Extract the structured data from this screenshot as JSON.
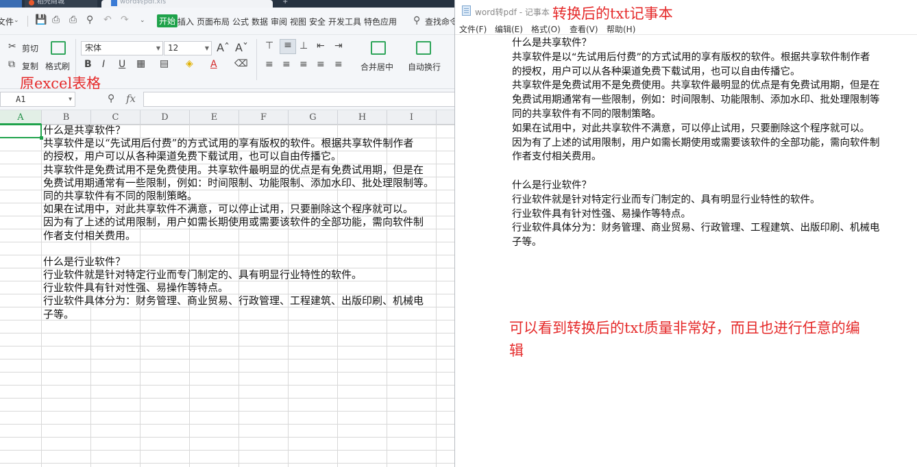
{
  "excel": {
    "tabs": {
      "t1": "稻壳商城",
      "t2": "word转pdf.xls",
      "plus": "+"
    },
    "menu": {
      "file": "文件",
      "items": [
        "开始",
        "插入",
        "页面布局",
        "公式",
        "数据",
        "审阅",
        "视图",
        "安全",
        "开发工具",
        "特色应用"
      ],
      "search": "查找命令"
    },
    "ribbon": {
      "cut": "剪切",
      "copy": "复制",
      "format_painter": "格式刷",
      "font_name": "宋体",
      "font_size": "12",
      "merge_center": "合并居中",
      "wrap_text": "自动换行"
    },
    "annotation": "原excel表格",
    "name_box": "A1",
    "fx_label": "fx",
    "columns": [
      "A",
      "B",
      "C",
      "D",
      "E",
      "F",
      "G",
      "H",
      "I"
    ],
    "cell_lines": [
      "什么是共享软件？",
      "共享软件是以“先试用后付费”的方式试用的享有版权的软件。根据共享软件制作者",
      "的授权，用户可以从各种渠道免费下载试用，也可以自由传播它。",
      "共享软件是免费试用不是免费使用。共享软件最明显的优点是有免费试用期，但是在",
      "免费试用期通常有一些限制，例如：时间限制、功能限制、添加水印、批处理限制等。",
      "同的共享软件有不同的限制策略。",
      "如果在试用中，对此共享软件不满意，可以停止试用，只要删除这个程序就可以。",
      "因为有了上述的试用限制，用户如需长期使用或需要该软件的全部功能，需向软件制",
      "作者支付相关费用。",
      "",
      "什么是行业软件？",
      "行业软件就是针对特定行业而专门制定的、具有明显行业特性的软件。",
      "行业软件具有针对性强、易操作等特点。",
      "行业软件具体分为：财务管理、商业贸易、行政管理、工程建筑、出版印刷、机械电",
      "子等。"
    ]
  },
  "notepad": {
    "title": "word转pdf - 记事本",
    "annotation_top": "转换后的txt记事本",
    "menu": [
      "文件(F)",
      "编辑(E)",
      "格式(O)",
      "查看(V)",
      "帮助(H)"
    ],
    "lines": [
      "什么是共享软件？",
      "共享软件是以“先试用后付费”的方式试用的享有版权的软件。根据共享软件制作者",
      "的授权，用户可以从各种渠道免费下载试用，也可以自由传播它。",
      "共享软件是免费试用不是免费使用。共享软件最明显的优点是有免费试用期，但是在",
      "免费试用期通常有一些限制，例如：时间限制、功能限制、添加水印、批处理限制等",
      "同的共享软件有不同的限制策略。",
      "如果在试用中，对此共享软件不满意，可以停止试用，只要删除这个程序就可以。",
      "因为有了上述的试用限制，用户如需长期使用或需要该软件的全部功能，需向软件制",
      "作者支付相关费用。",
      "",
      "什么是行业软件？",
      "行业软件就是针对特定行业而专门制定的、具有明显行业特性的软件。",
      "行业软件具有针对性强、易操作等特点。",
      "行业软件具体分为：财务管理、商业贸易、行政管理、工程建筑、出版印刷、机械电",
      "子等。"
    ],
    "annotation_bottom": [
      "可以看到转换后的txt质量非常好，而且也进行任意的编",
      "辑"
    ]
  },
  "colors": {
    "annotation": "#e52a2a",
    "accent": "#1ea24a",
    "tabbar": "#263240"
  },
  "icons": [
    "save-icon",
    "print-icon",
    "print-preview-icon",
    "undo-icon",
    "redo-icon",
    "search-icon",
    "scissors-icon",
    "copy-icon",
    "format-painter-icon",
    "notepad-icon",
    "zoom-icon"
  ]
}
